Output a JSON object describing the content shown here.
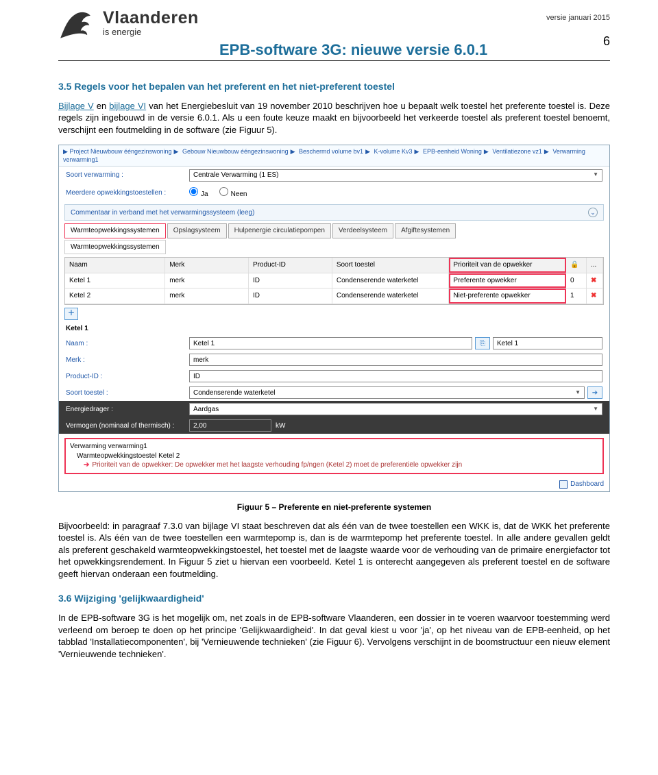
{
  "header": {
    "brand": "Vlaanderen",
    "tagline": "is energie",
    "doc_title": "EPB-software 3G: nieuwe versie 6.0.1",
    "meta": "versie januari 2015",
    "page_num": "6"
  },
  "sec35": {
    "heading": "3.5 Regels voor het bepalen van het preferent en het niet-preferent toestel",
    "link1": "Bijlage V",
    "mid1": " en ",
    "link2": "bijlage VI",
    "p1_rest": " van het Energiebesluit van 19 november 2010 beschrijven hoe u bepaalt welk toestel het preferente toestel is. Deze regels zijn ingebouwd in de versie 6.0.1. Als u een foute keuze maakt en bijvoorbeeld het verkeerde toestel als preferent toestel benoemt, verschijnt een foutmelding in de software (zie Figuur 5)."
  },
  "shot": {
    "breadcrumbs": [
      "Project Nieuwbouw ééngezinswoning",
      "Gebouw Nieuwbouw ééngezinswoning",
      "Beschermd volume bv1",
      "K-volume Kv3",
      "EPB-eenheid Woning",
      "Ventilatiezone vz1",
      "Verwarming verwarming1"
    ],
    "row_soort": {
      "label": "Soort verwarming :",
      "value": "Centrale Verwarming (1 ES)"
    },
    "row_meerdere": {
      "label": "Meerdere opwekkingstoestellen :",
      "opt_ja": "Ja",
      "opt_neen": "Neen"
    },
    "section_comment": "Commentaar in verband met het verwarmingssysteem  (leeg)",
    "tabs": [
      "Warmteopwekkingssystemen",
      "Opslagsysteem",
      "Hulpenergie circulatiepompen",
      "Verdeelsysteem",
      "Afgiftesystemen"
    ],
    "subtab": "Warmteopwekkingssystemen",
    "thead": [
      "Naam",
      "Merk",
      "Product-ID",
      "Soort toestel",
      "Prioriteit van de opwekker",
      "",
      "..."
    ],
    "rows": [
      {
        "naam": "Ketel 1",
        "merk": "merk",
        "pid": "ID",
        "soort": "Condenserende waterketel",
        "prio": "Preferente opwekker",
        "idx": "0"
      },
      {
        "naam": "Ketel 2",
        "merk": "merk",
        "pid": "ID",
        "soort": "Condenserende waterketel",
        "prio": "Niet-preferente opwekker",
        "idx": "1"
      }
    ],
    "ketel_title": "Ketel 1",
    "props": {
      "naam_label": "Naam :",
      "naam_val": "Ketel 1",
      "naam_side": "Ketel 1",
      "merk_label": "Merk :",
      "merk_val": "merk",
      "pid_label": "Product-ID :",
      "pid_val": "ID",
      "soort_label": "Soort toestel :",
      "soort_val": "Condenserende waterketel",
      "energie_label": "Energiedrager :",
      "energie_val": "Aardgas",
      "vermogen_label": "Vermogen (nominaal of thermisch) :",
      "vermogen_val": "2,00",
      "unit": "kW"
    },
    "err": {
      "loc1": "Verwarming verwarming1",
      "loc2": "Warmteopwekkingstoestel Ketel 2",
      "text": "Prioriteit van de opwekker: De opwekker met het laagste verhouding fp/ngen (Ketel 2) moet de preferentiële opwekker zijn"
    },
    "dashboard": "Dashboard"
  },
  "caption": "Figuur 5 – Preferente en niet-preferente systemen",
  "p2": "Bijvoorbeeld: in paragraaf 7.3.0 van bijlage VI staat beschreven dat als één van de twee toestellen een WKK is, dat de WKK het preferente toestel is. Als één van de twee toestellen een warmtepomp is, dan is de warmtepomp het preferente toestel. In alle andere gevallen geldt als preferent geschakeld warmteopwekkingstoestel, het toestel met de laagste waarde voor de verhouding van de primaire energiefactor tot het opwekkingsrendement. In Figuur 5 ziet u hiervan een voorbeeld. Ketel 1 is onterecht aangegeven als preferent toestel en de software geeft hiervan onderaan een foutmelding.",
  "sec36": {
    "heading": "3.6 Wijziging 'gelijkwaardigheid'",
    "p": "In de EPB-software 3G is het mogelijk om, net zoals in de EPB-software Vlaanderen, een dossier in te voeren waarvoor toestemming werd verleend om beroep te doen op het principe 'Gelijkwaardigheid'. In dat geval kiest u voor 'ja', op het niveau van de EPB-eenheid, op het tabblad 'Installatiecomponenten', bij 'Vernieuwende technieken' (zie Figuur 6). Vervolgens verschijnt in de boomstructuur een nieuw element 'Vernieuwende technieken'."
  }
}
